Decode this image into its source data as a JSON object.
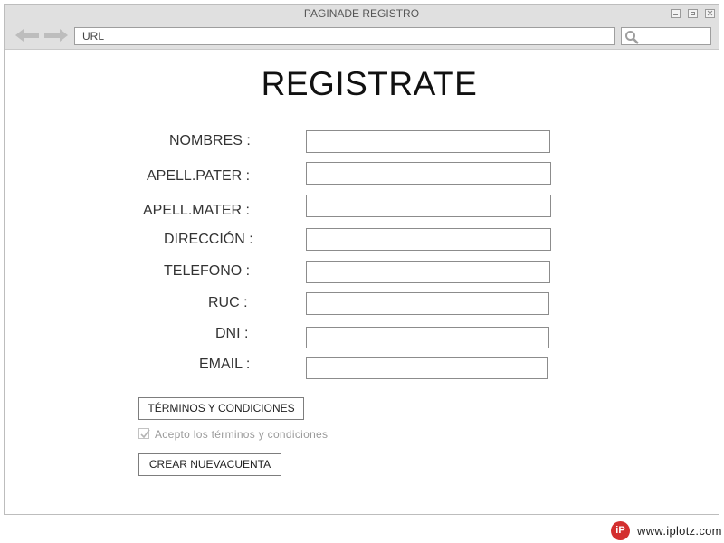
{
  "window": {
    "title": "PAGINADE REGISTRO",
    "url_placeholder": "URL",
    "search_value": ""
  },
  "form": {
    "heading": "REGISTRATE",
    "fields": [
      {
        "label": "NOMBRES :",
        "value": ""
      },
      {
        "label": "APELL.PATER :",
        "value": ""
      },
      {
        "label": "APELL.MATER :",
        "value": ""
      },
      {
        "label": "DIRECCIÓN :",
        "value": ""
      },
      {
        "label": "TELEFONO :",
        "value": ""
      },
      {
        "label": "RUC :",
        "value": ""
      },
      {
        "label": "DNI :",
        "value": ""
      },
      {
        "label": "EMAIL :",
        "value": ""
      }
    ],
    "terms_button": "TÉRMINOS Y CONDICIONES",
    "accept_label": "Acepto los términos y condiciones",
    "accept_checked": true,
    "create_button": "CREAR NUEVACUENTA"
  },
  "brand": {
    "logo_text": "iP",
    "site": "www.iplotz.com",
    "color": "#d32f2f"
  },
  "icons": {
    "back": "arrow-left-icon",
    "forward": "arrow-right-icon",
    "search": "search-icon",
    "minimize": "minimize-icon",
    "maximize": "maximize-icon",
    "close": "close-icon",
    "check": "checkmark-icon"
  }
}
